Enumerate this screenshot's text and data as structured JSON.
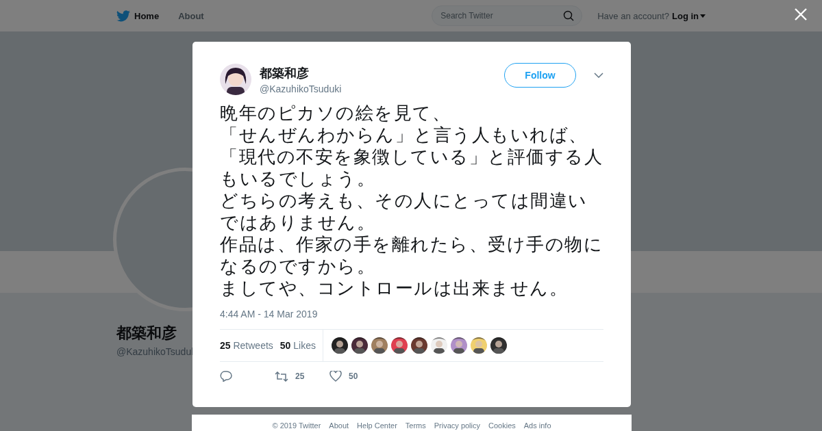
{
  "header": {
    "nav": [
      {
        "label": "Home",
        "selected": true
      },
      {
        "label": "About",
        "selected": false
      }
    ],
    "search": {
      "placeholder": "Search Twitter"
    },
    "account_prompt": "Have an account?",
    "login": "Log in"
  },
  "profile": {
    "name": "都築和彦",
    "handle": "@KazuhikoTsudul"
  },
  "tweet": {
    "name": "都築和彦",
    "handle": "@KazuhikoTsuduki",
    "follow": "Follow",
    "lines": [
      "晩年のピカソの絵を見て、",
      "「せんぜんわからん」と言う人もいれば、",
      "「現代の不安を象徴している」と評価する人",
      "もいるでしょう。",
      "どちらの考えも、その人にとっては間違い",
      "ではありません。",
      "作品は、作家の手を離れたら、受け手の物に",
      "なるのですから。",
      "ましてや、コントロールは出来ません。"
    ],
    "time": "4:44 AM - 14 Mar 2019",
    "stats": [
      {
        "count": "25",
        "label": "Retweets"
      },
      {
        "count": "50",
        "label": "Likes"
      }
    ],
    "likers": [
      {
        "color": "#222222"
      },
      {
        "color": "#4a2a3a"
      },
      {
        "color": "#a08060"
      },
      {
        "color": "#e04050"
      },
      {
        "color": "#6a3a30"
      },
      {
        "color": "#f0f0f0"
      },
      {
        "color": "#b090c8"
      },
      {
        "color": "#f0d070"
      },
      {
        "color": "#303030"
      }
    ],
    "actions": [
      {
        "kind": "reply"
      },
      {
        "kind": "retweet",
        "count": "25"
      },
      {
        "kind": "like",
        "count": "50"
      }
    ]
  },
  "footer": [
    "© 2019 Twitter",
    "About",
    "Help Center",
    "Terms",
    "Privacy policy",
    "Cookies",
    "Ads info"
  ]
}
